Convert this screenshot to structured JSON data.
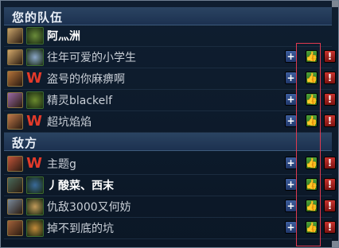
{
  "teams": [
    {
      "title": "您的队伍",
      "players": [
        {
          "name": "阿灬洲",
          "champ_color": "#c9a46a",
          "emblem": "guild",
          "emblem_color": "#6a8c3a",
          "bright": true,
          "actions": false
        },
        {
          "name": "往年可爱的小学生",
          "champ_color": "#d2a86a",
          "emblem": "guild",
          "emblem_color": "#8aa6c8",
          "bright": false,
          "actions": true
        },
        {
          "name": "盗号的你麻痹啊",
          "champ_color": "#b5743a",
          "emblem": "w",
          "emblem_color": "#e23a2a",
          "bright": false,
          "actions": true
        },
        {
          "name": "精灵blackelf",
          "champ_color": "#9a6aa6",
          "emblem": "guild",
          "emblem_color": "#6b8a2e",
          "bright": false,
          "actions": true
        },
        {
          "name": "超坑焰焰",
          "champ_color": "#c27a4a",
          "emblem": "w",
          "emblem_color": "#e23a2a",
          "bright": false,
          "actions": true
        }
      ]
    },
    {
      "title": "敌方",
      "players": [
        {
          "name": "主题g",
          "champ_color": "#c2553a",
          "emblem": "w",
          "emblem_color": "#e23a2a",
          "bright": false,
          "actions": true
        },
        {
          "name": "丿酸菜、西末",
          "champ_color": "#4a6a5a",
          "emblem": "guild",
          "emblem_color": "#3a6a9a",
          "bright": true,
          "actions": true
        },
        {
          "name": "仇敌3000又何妨",
          "champ_color": "#7a8a9a",
          "emblem": "guild",
          "emblem_color": "#c29a5a",
          "bright": false,
          "actions": true
        },
        {
          "name": "掉不到底的坑",
          "champ_color": "#a2623a",
          "emblem": "guild",
          "emblem_color": "#c28a3a",
          "bright": false,
          "actions": true
        }
      ]
    }
  ],
  "buttons": {
    "add": "+",
    "like": "👍",
    "report": "!"
  }
}
